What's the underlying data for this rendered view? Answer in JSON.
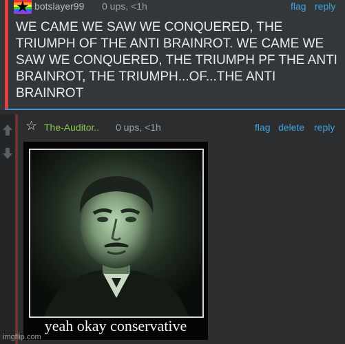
{
  "comment1": {
    "username": "botslayer99",
    "meta": "0 ups, <1h",
    "flag": "flag",
    "reply": "reply",
    "body": "WE CAME WE SAW WE CONQUERED, THE TRIUMPH OF THE ANTI BRAINROT. WE CAME WE SAW WE CONQUERED, THE TRIUMPH PF THE ANTI BRAINROT, THE TRIUMPH...OF...THE ANTI BRAINROT"
  },
  "comment2": {
    "username": "The-Auditor..",
    "meta": "0 ups, <1h",
    "flag": "flag",
    "delete": "delete",
    "reply": "reply",
    "image_caption": "yeah okay conservative"
  },
  "votes": {
    "up_icon": "up-arrow-icon",
    "down_icon": "down-arrow-icon"
  },
  "watermark": "imgflip.com",
  "colors": {
    "link": "#3ea1e0",
    "username2": "#8bc34a",
    "accent_red": "#e04040",
    "accent_blue": "#4a8fd0"
  }
}
